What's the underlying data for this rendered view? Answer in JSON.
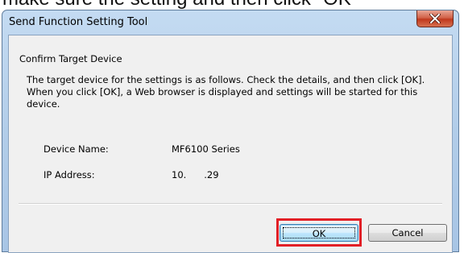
{
  "caption": "make sure the setting and then click \"OK\"",
  "window": {
    "title": "Send Function Setting Tool"
  },
  "content": {
    "heading": "Confirm Target Device",
    "description": "The target device for the settings is as follows. Check the details, and then click [OK]. When you click [OK], a Web browser is displayed and settings will be started for this device.",
    "fields": [
      {
        "label": "Device Name:",
        "value": "MF6100 Series"
      },
      {
        "label": "IP Address:",
        "value": "10.      .29"
      }
    ]
  },
  "buttons": {
    "ok": "OK",
    "cancel": "Cancel"
  },
  "icons": {
    "close": "close-icon"
  },
  "colors": {
    "highlight": "#e21f26",
    "close_button": "#c0391c"
  }
}
